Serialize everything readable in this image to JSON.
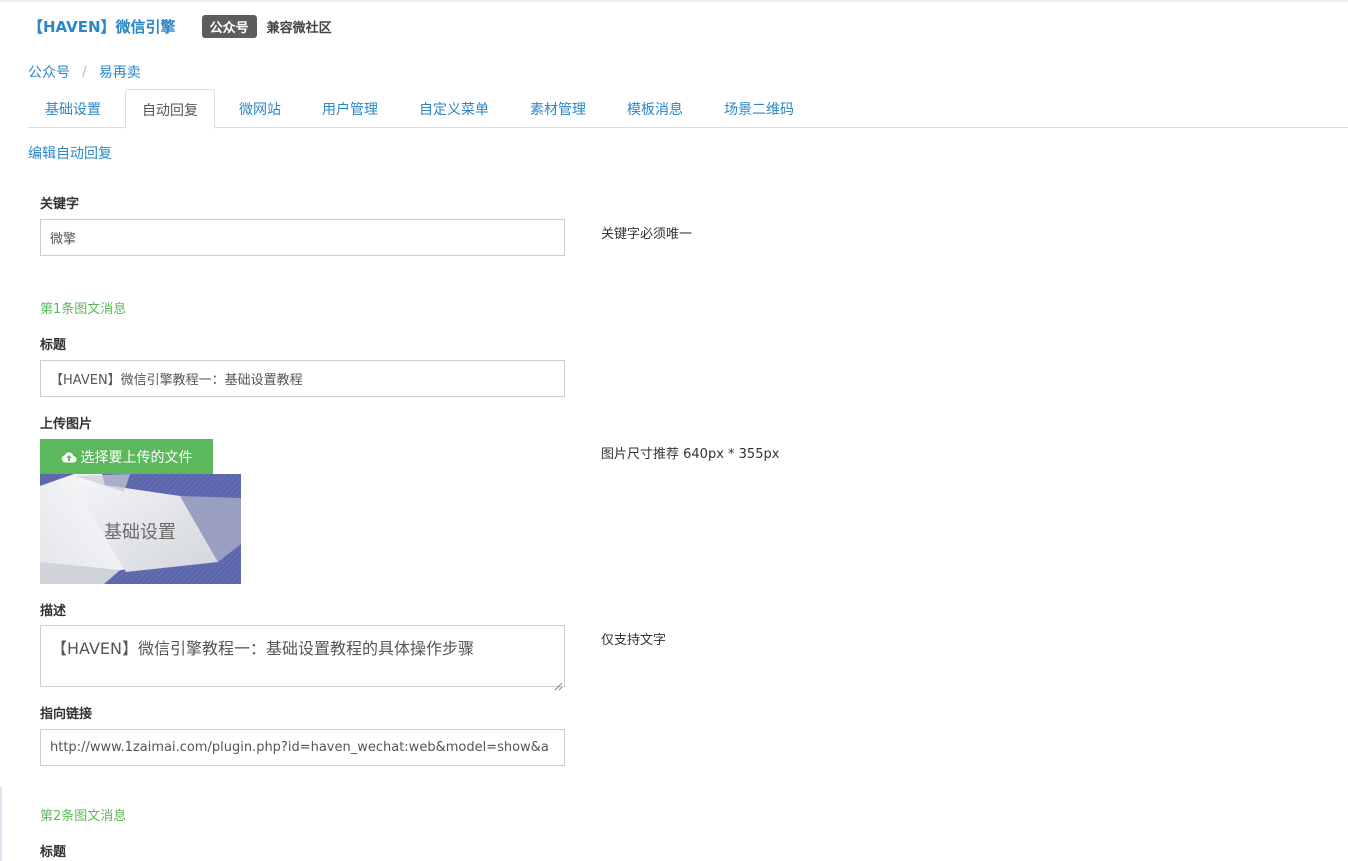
{
  "header": {
    "app_title": "【HAVEN】微信引擎",
    "badge": "公众号",
    "badge_note": "兼容微社区"
  },
  "breadcrumb": [
    "公众号",
    "易再卖"
  ],
  "breadcrumb_separator": "/",
  "tabs": [
    {
      "label": "基础设置",
      "active": false
    },
    {
      "label": "自动回复",
      "active": true
    },
    {
      "label": "微网站",
      "active": false
    },
    {
      "label": "用户管理",
      "active": false
    },
    {
      "label": "自定义菜单",
      "active": false
    },
    {
      "label": "素材管理",
      "active": false
    },
    {
      "label": "模板消息",
      "active": false
    },
    {
      "label": "场景二维码",
      "active": false
    }
  ],
  "page_subtitle": "编辑自动回复",
  "form": {
    "keyword": {
      "label": "关键字",
      "value": "微擎",
      "hint": "关键字必须唯一"
    },
    "item1": {
      "section_title": "第1条图文消息",
      "title_label": "标题",
      "title_value": "【HAVEN】微信引擎教程一：基础设置教程",
      "image_label": "上传图片",
      "upload_button": "选择要上传的文件",
      "image_hint": "图片尺寸推荐 640px * 355px",
      "preview_text": "基础设置",
      "desc_label": "描述",
      "desc_value": "【HAVEN】微信引擎教程一：基础设置教程的具体操作步骤",
      "desc_hint": "仅支持文字",
      "link_label": "指向链接",
      "link_value": "http://www.1zaimai.com/plugin.php?id=haven_wechat:web&model=show&a"
    },
    "item2": {
      "section_title": "第2条图文消息",
      "title_label": "标题"
    }
  },
  "colors": {
    "link_blue": "#2a87c9",
    "success_green": "#5cb85c",
    "badge_gray": "#5d5d5d"
  },
  "icons": {
    "upload": "cloud-upload-icon"
  }
}
